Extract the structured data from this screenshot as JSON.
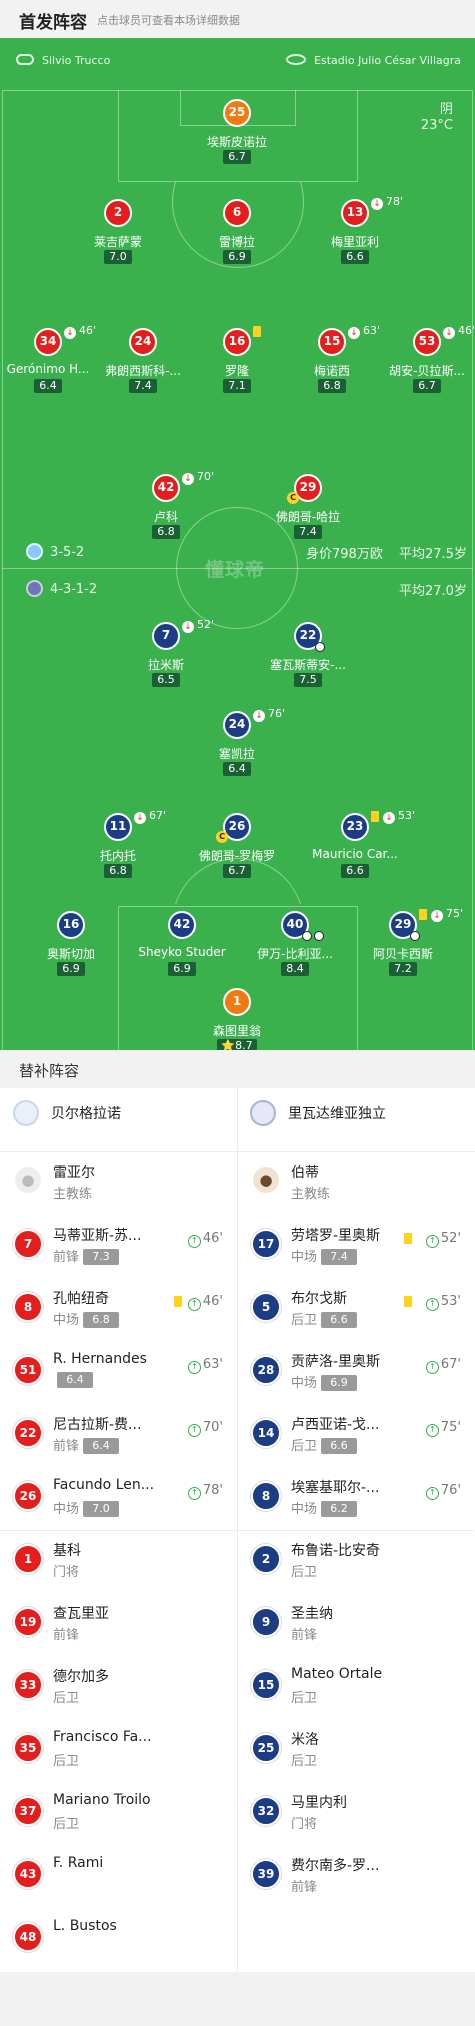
{
  "header": {
    "title": "首发阵容",
    "subtitle": "点击球员可查看本场详细数据"
  },
  "pitch": {
    "referee": "Silvio Trucco",
    "venue": "Estadio Julio César Villagra",
    "weather": "阴",
    "temperature": "23°C",
    "watermark": "懂球帝",
    "home_formation": "3-5-2",
    "away_formation": "4-3-1-2",
    "home_value": "身价798万欧",
    "home_avg_age": "平均27.5岁",
    "away_avg_age": "平均27.0岁"
  },
  "players": [
    {
      "num": "25",
      "name": "埃斯皮诺拉",
      "rating": "6.7",
      "color": "orange"
    },
    {
      "num": "2",
      "name": "莱吉萨蒙",
      "rating": "7.0",
      "color": "red"
    },
    {
      "num": "6",
      "name": "雷博拉",
      "rating": "6.9",
      "color": "red"
    },
    {
      "num": "13",
      "name": "梅里亚利",
      "rating": "6.6",
      "color": "red",
      "sub": "78'"
    },
    {
      "num": "34",
      "name": "Gerónimo H...",
      "rating": "6.4",
      "color": "red",
      "sub": "46'"
    },
    {
      "num": "24",
      "name": "弗朗西斯科-...",
      "rating": "7.4",
      "color": "red"
    },
    {
      "num": "16",
      "name": "罗隆",
      "rating": "7.1",
      "color": "red",
      "yellow": true
    },
    {
      "num": "15",
      "name": "梅诺西",
      "rating": "6.8",
      "color": "red",
      "sub": "63'"
    },
    {
      "num": "53",
      "name": "胡安-贝拉斯...",
      "rating": "6.7",
      "color": "red",
      "sub": "46'"
    },
    {
      "num": "42",
      "name": "卢科",
      "rating": "6.8",
      "color": "red",
      "sub": "70'"
    },
    {
      "num": "29",
      "name": "佛朗哥-哈拉",
      "rating": "7.4",
      "color": "red",
      "captain": "C"
    },
    {
      "num": "7",
      "name": "拉米斯",
      "rating": "6.5",
      "color": "blue",
      "sub": "52'"
    },
    {
      "num": "22",
      "name": "塞瓦斯蒂安-...",
      "rating": "7.5",
      "color": "blue",
      "goal": true
    },
    {
      "num": "24",
      "name": "塞凯拉",
      "rating": "6.4",
      "color": "blue",
      "sub": "76'"
    },
    {
      "num": "11",
      "name": "托内托",
      "rating": "6.8",
      "color": "blue",
      "sub": "67'"
    },
    {
      "num": "26",
      "name": "佛朗哥-罗梅罗",
      "rating": "6.7",
      "color": "blue",
      "captain": "C"
    },
    {
      "num": "23",
      "name": "Mauricio Car...",
      "rating": "6.6",
      "color": "blue",
      "sub": "53'",
      "yellow": true
    },
    {
      "num": "16",
      "name": "奥斯切加",
      "rating": "6.9",
      "color": "blue"
    },
    {
      "num": "42",
      "name": "Sheyko Studer",
      "rating": "6.9",
      "color": "blue"
    },
    {
      "num": "40",
      "name": "伊万-比利亚...",
      "rating": "8.4",
      "color": "blue",
      "goal": true,
      "goal2": true
    },
    {
      "num": "29",
      "name": "阿贝卡西斯",
      "rating": "7.2",
      "color": "blue",
      "sub": "75'",
      "yellow": true,
      "goal": true
    },
    {
      "num": "1",
      "name": "森图里翁",
      "rating": "8.7",
      "color": "orange",
      "star": "⭐"
    }
  ],
  "subs_title": "替补阵容",
  "home_team": {
    "name": "贝尔格拉诺",
    "coach": "雷亚尔",
    "coach_role": "主教练"
  },
  "away_team": {
    "name": "里瓦达维亚独立",
    "coach": "伯蒂",
    "coach_role": "主教练"
  },
  "home_subs": [
    {
      "num": "7",
      "name": "马蒂亚斯-苏...",
      "pos": "前锋",
      "rating": "7.3",
      "min": "46'",
      "color": "red"
    },
    {
      "num": "8",
      "name": "孔帕纽奇",
      "pos": "中场",
      "rating": "6.8",
      "min": "46'",
      "color": "red",
      "yellow": true
    },
    {
      "num": "51",
      "name": "R. Hernandes",
      "pos": "",
      "rating": "6.4",
      "min": "63'",
      "color": "red"
    },
    {
      "num": "22",
      "name": "尼古拉斯-费...",
      "pos": "前锋",
      "rating": "6.4",
      "min": "70'",
      "color": "red"
    },
    {
      "num": "26",
      "name": "Facundo Len...",
      "pos": "中场",
      "rating": "7.0",
      "min": "78'",
      "color": "red"
    },
    {
      "num": "1",
      "name": "基科",
      "pos": "门将",
      "color": "red"
    },
    {
      "num": "19",
      "name": "查瓦里亚",
      "pos": "前锋",
      "color": "red"
    },
    {
      "num": "33",
      "name": "德尔加多",
      "pos": "后卫",
      "color": "red"
    },
    {
      "num": "35",
      "name": "Francisco Fa...",
      "pos": "后卫",
      "color": "red"
    },
    {
      "num": "37",
      "name": "Mariano Troilo",
      "pos": "后卫",
      "color": "red"
    },
    {
      "num": "43",
      "name": "F. Rami",
      "pos": "",
      "color": "red"
    },
    {
      "num": "48",
      "name": "L. Bustos",
      "pos": "",
      "color": "red"
    }
  ],
  "away_subs": [
    {
      "num": "17",
      "name": "劳塔罗-里奥斯",
      "pos": "中场",
      "rating": "7.4",
      "min": "52'",
      "color": "blue",
      "yellow": true
    },
    {
      "num": "5",
      "name": "布尔戈斯",
      "pos": "后卫",
      "rating": "6.6",
      "min": "53'",
      "color": "blue",
      "yellow": true
    },
    {
      "num": "28",
      "name": "贡萨洛-里奥斯",
      "pos": "中场",
      "rating": "6.9",
      "min": "67'",
      "color": "blue"
    },
    {
      "num": "14",
      "name": "卢西亚诺-戈...",
      "pos": "后卫",
      "rating": "6.6",
      "min": "75'",
      "color": "blue"
    },
    {
      "num": "8",
      "name": "埃塞基耶尔-...",
      "pos": "中场",
      "rating": "6.2",
      "min": "76'",
      "color": "blue"
    },
    {
      "num": "2",
      "name": "布鲁诺-比安奇",
      "pos": "后卫",
      "color": "blue"
    },
    {
      "num": "9",
      "name": "圣圭纳",
      "pos": "前锋",
      "color": "blue"
    },
    {
      "num": "15",
      "name": "Mateo Ortale",
      "pos": "后卫",
      "color": "blue"
    },
    {
      "num": "25",
      "name": "米洛",
      "pos": "后卫",
      "color": "blue"
    },
    {
      "num": "32",
      "name": "马里内利",
      "pos": "门将",
      "color": "blue"
    },
    {
      "num": "39",
      "name": "费尔南多-罗...",
      "pos": "前锋",
      "color": "blue"
    }
  ]
}
